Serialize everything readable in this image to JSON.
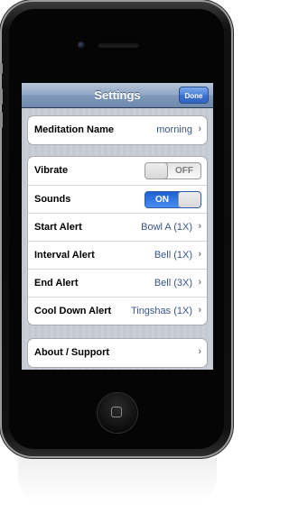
{
  "navbar": {
    "title": "Settings",
    "done_label": "Done"
  },
  "group1": {
    "rows": [
      {
        "label": "Meditation Name",
        "value": "morning"
      }
    ]
  },
  "group2": {
    "vibrate": {
      "label": "Vibrate",
      "state": "OFF"
    },
    "sounds": {
      "label": "Sounds",
      "state": "ON"
    },
    "rows": [
      {
        "label": "Start Alert",
        "value": "Bowl A (1X)"
      },
      {
        "label": "Interval Alert",
        "value": "Bell (1X)"
      },
      {
        "label": "End Alert",
        "value": "Bell (3X)"
      },
      {
        "label": "Cool Down Alert",
        "value": "Tingshas (1X)"
      }
    ]
  },
  "group3": {
    "rows": [
      {
        "label": "About / Support"
      }
    ]
  },
  "icons": {
    "disclosure": "chevron-right-icon",
    "home": "home-button-icon"
  },
  "colors": {
    "value_text": "#385487",
    "toggle_on": "#2f74e0",
    "navbar": "#7f98b8"
  }
}
